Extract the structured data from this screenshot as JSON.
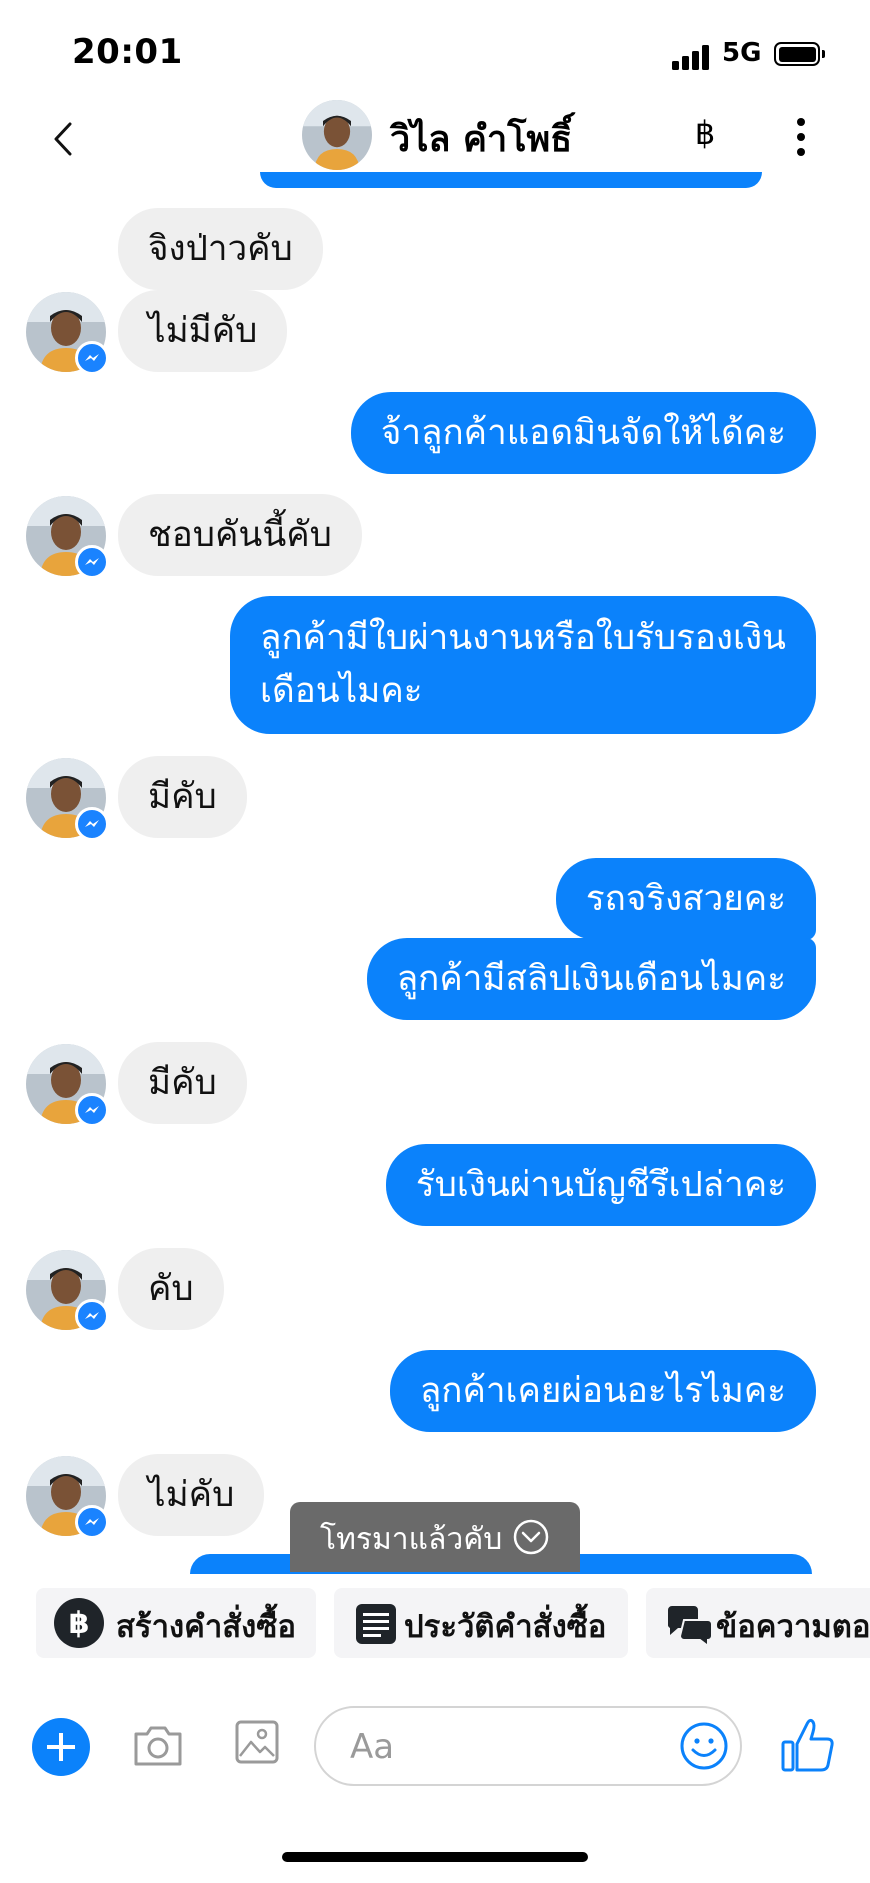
{
  "status_bar": {
    "time": "20:01",
    "network": "5G"
  },
  "header": {
    "contact_name": "วิไล คำโพธิ์",
    "currency_icon": "฿"
  },
  "messages": [
    {
      "side": "in",
      "text": "จิงป่าวคับ"
    },
    {
      "side": "in",
      "text": "ไม่มีคับ"
    },
    {
      "side": "out",
      "text": "จ้าลูกค้าแอดมินจัดให้ได้คะ"
    },
    {
      "side": "in",
      "text": "ชอบคันนี้คับ"
    },
    {
      "side": "out",
      "lines": [
        "ลูกค้ามีใบผ่านงานหรือใบรับรองเงิน",
        "เดือนไมคะ"
      ]
    },
    {
      "side": "in",
      "text": "มีคับ"
    },
    {
      "side": "out",
      "text": "รถจริงสวยคะ"
    },
    {
      "side": "out",
      "text": "ลูกค้ามีสลิปเงินเดือนไมคะ"
    },
    {
      "side": "in",
      "text": "มีคับ"
    },
    {
      "side": "out",
      "text": "รับเงินผ่านบัญชีรึเปล่าคะ"
    },
    {
      "side": "in",
      "text": "คับ"
    },
    {
      "side": "out",
      "text": "ลูกค้าเคยผ่อนอะไรไมคะ"
    },
    {
      "side": "in",
      "text": "ไม่คับ"
    }
  ],
  "toast": {
    "label": "โทรมาแล้วคับ"
  },
  "quick_actions": [
    {
      "label": "สร้างคำสั่งซื้อ",
      "icon": "baht-circle-icon"
    },
    {
      "label": "ประวัติคำสั่งซื้อ",
      "icon": "list-icon"
    },
    {
      "label": "ข้อความตอ",
      "icon": "chat-bubbles-icon"
    }
  ],
  "composer": {
    "placeholder": "Aa"
  },
  "colors": {
    "accent": "#0b82fb",
    "incoming_bubble": "#efefef",
    "toast": "#6a6a6a"
  }
}
